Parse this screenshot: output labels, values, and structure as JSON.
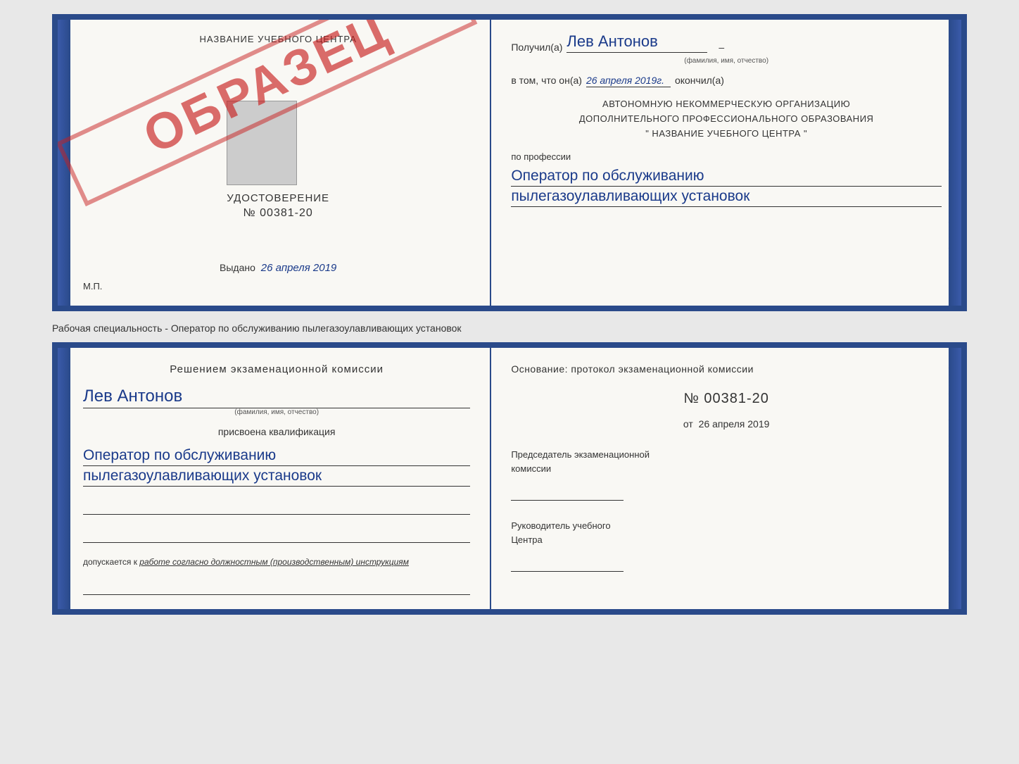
{
  "top_doc": {
    "left": {
      "school_name": "НАЗВАНИЕ УЧЕБНОГО ЦЕНТРА",
      "udostoverenie_label": "УДОСТОВЕРЕНИЕ",
      "udostoverenie_number": "№ 00381-20",
      "obrazec": "ОБРАЗЕЦ",
      "vydano_label": "Выдано",
      "vydano_date": "26 апреля 2019",
      "mp_label": "М.П."
    },
    "right": {
      "poluchil_label": "Получил(а)",
      "recipient_name": "Лев Антонов",
      "fio_subtitle": "(фамилия, имя, отчество)",
      "dash1": "–",
      "vtom_label": "в том, что он(а)",
      "completion_date": "26 апреля 2019г.",
      "okonchil_label": "окончил(а)",
      "org_line1": "АВТОНОМНУЮ НЕКОММЕРЧЕСКУЮ ОРГАНИЗАЦИЮ",
      "org_line2": "ДОПОЛНИТЕЛЬНОГО ПРОФЕССИОНАЛЬНОГО ОБРАЗОВАНИЯ",
      "org_line3": "\"  НАЗВАНИЕ УЧЕБНОГО ЦЕНТРА   \"",
      "po_professii": "по профессии",
      "profession1": "Оператор по обслуживанию",
      "profession2": "пылегазоулавливающих установок"
    }
  },
  "middle_text": "Рабочая специальность - Оператор по обслуживанию пылегазоулавливающих установок",
  "bottom_doc": {
    "left": {
      "komissia_line1": "Решением экзаменационной  комиссии",
      "recipient_name": "Лев Антонов",
      "fio_subtitle": "(фамилия, имя, отчество)",
      "prisvoena": "присвоена квалификация",
      "profession1": "Оператор по обслуживанию",
      "profession2": "пылегазоулавливающих установок",
      "dopusk_prefix": "допускается к ",
      "dopusk_italic": "работе согласно должностным (производственным) инструкциям"
    },
    "right": {
      "osnovanie_label": "Основание: протокол экзаменационной  комиссии",
      "number": "№  00381-20",
      "ot_label": "от",
      "ot_date": "26 апреля 2019",
      "predsedatel_line1": "Председатель экзаменационной",
      "predsedatel_line2": "комиссии",
      "rukovoditel_line1": "Руководитель учебного",
      "rukovoditel_line2": "Центра"
    }
  }
}
